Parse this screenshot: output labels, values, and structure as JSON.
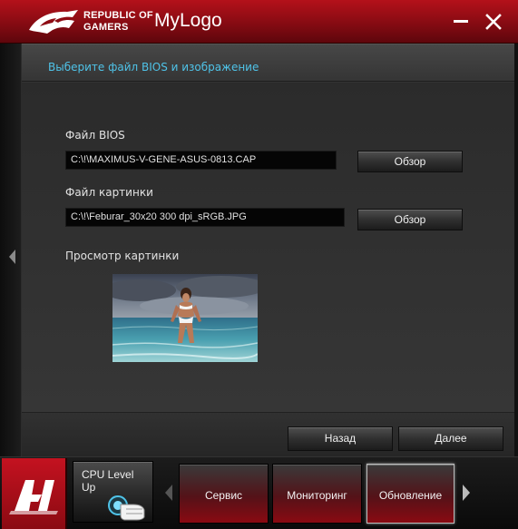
{
  "window": {
    "brand_line1": "REPUBLIC OF",
    "brand_line2": "GAMERS",
    "app_title": "MyLogo",
    "minimize_icon": "minimize-icon",
    "close_icon": "close-icon"
  },
  "main": {
    "header_text": "Выберите файл BIOS и изображение",
    "bios_label": "Файл BIOS",
    "bios_path": "C:\\!\\MAXIMUS-V-GENE-ASUS-0813.CAP",
    "bios_browse": "Обзор",
    "image_label": "Файл картинки",
    "image_path": "C:\\!\\Feburar_30x20 300 dpi_sRGB.JPG",
    "image_browse": "Обзор",
    "preview_label": "Просмотр картинки",
    "back_button": "Назад",
    "next_button": "Далее"
  },
  "bottombar": {
    "ai_suite_icon": "ai-suite-logo-icon",
    "cpu_level_up": "CPU Level Up",
    "nav_items": [
      {
        "label": "Сервис"
      },
      {
        "label": "Мониторинг"
      },
      {
        "label": "Обновление"
      }
    ]
  },
  "colors": {
    "accent_red": "#b4111a",
    "header_text": "#4fc3e8",
    "panel_bg": "#333333"
  }
}
